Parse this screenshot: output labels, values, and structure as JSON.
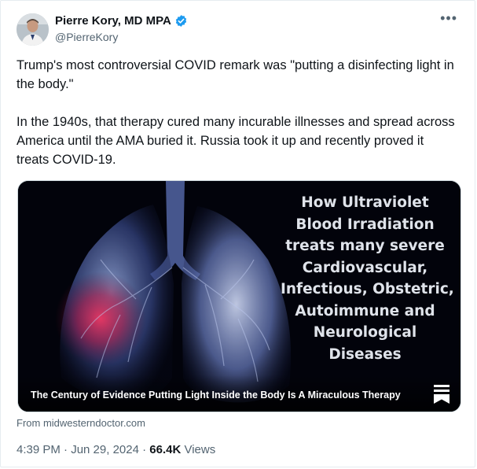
{
  "tweet": {
    "author_name": "Pierre Kory, MD MPA",
    "handle": "@PierreKory",
    "verified_icon": "verified-badge-icon",
    "more_icon": "more-options-icon",
    "paragraph_1": "Trump's most controversial COVID remark was \"putting a disinfecting light in the body.\"",
    "paragraph_2": "In the 1940s, that therapy cured many incurable illnesses and spread across America until the AMA buried it. Russia took it up and recently proved it treats COVID-19."
  },
  "card": {
    "overlay_lines": [
      "How Ultraviolet",
      "Blood Irradiation",
      "treats many severe",
      "Cardiovascular,",
      "Infectious, Obstetric,",
      "Autoimmune and",
      "Neurological",
      "Diseases"
    ],
    "caption": "The Century of Evidence Putting Light Inside the Body Is A Miraculous Therapy",
    "source": "From midwesterndoctor.com",
    "bookmark_icon": "substack-logo-icon"
  },
  "meta": {
    "time_date": "4:39 PM · Jun 29, 2024 · ",
    "views_count": "66.4K",
    "views_label": " Views"
  },
  "colors": {
    "verified_blue": "#1d9bf0",
    "secondary_text": "#536471",
    "lung_blue": "#6f86c8",
    "highlight_red": "#d21f4a"
  }
}
